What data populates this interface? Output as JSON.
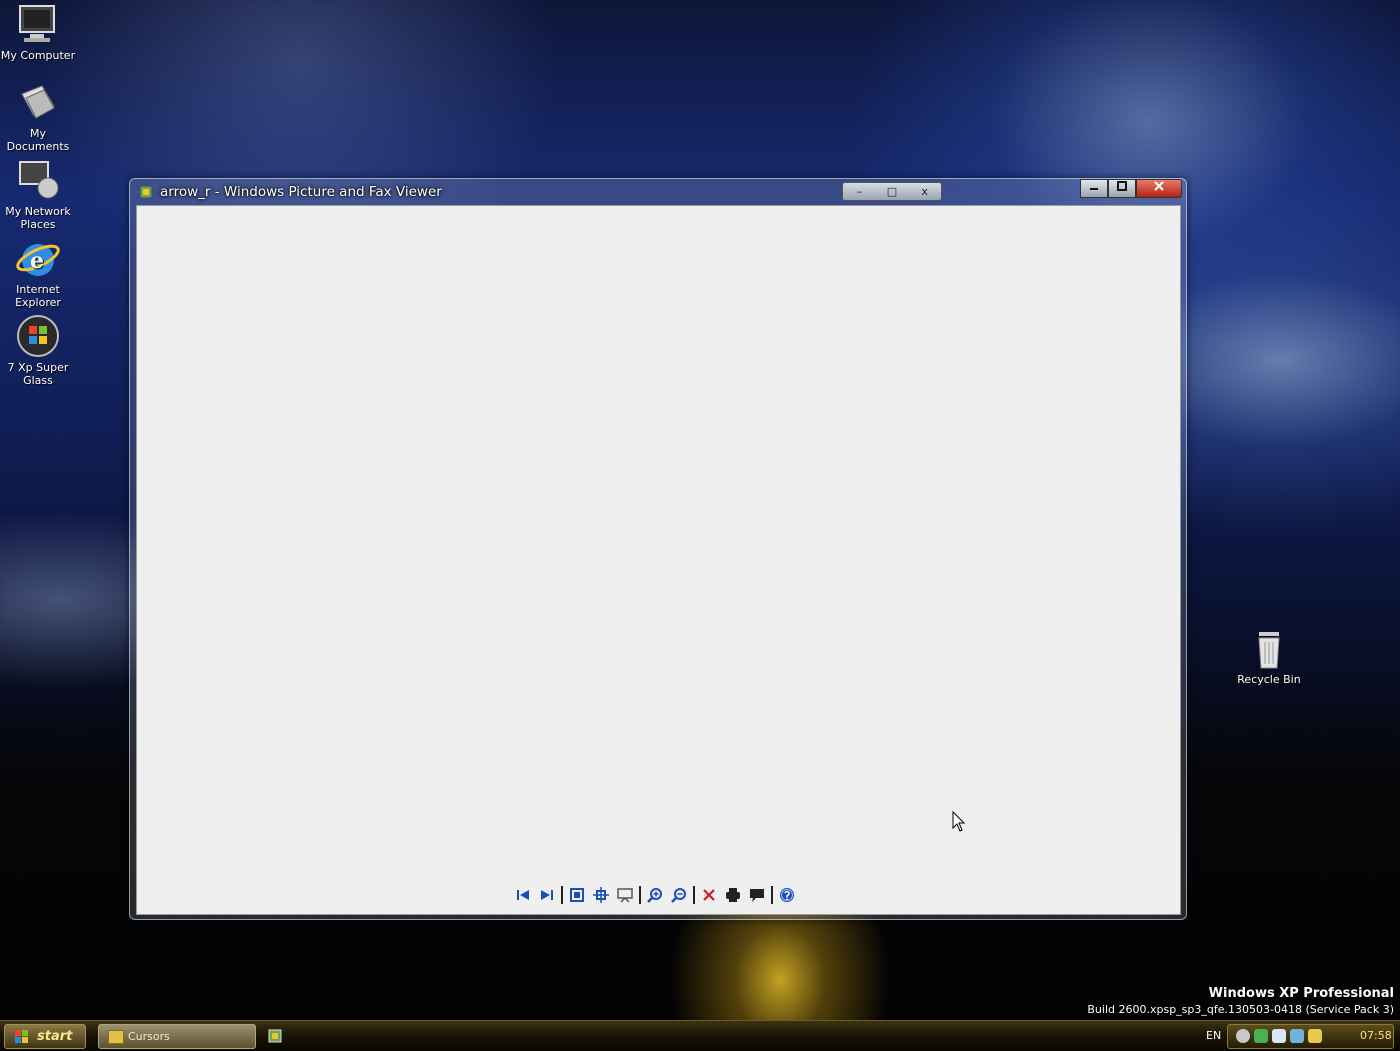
{
  "desktop": {
    "icons": [
      {
        "label": "My Computer",
        "icon": "my-computer-icon"
      },
      {
        "label": "My Documents",
        "icon": "my-documents-icon"
      },
      {
        "label": "My Network Places",
        "icon": "network-places-icon"
      },
      {
        "label": "Internet Explorer",
        "icon": "internet-explorer-icon"
      },
      {
        "label": "7 Xp Super Glass",
        "icon": "windows-orb-icon"
      },
      {
        "label": "Recycle Bin",
        "icon": "recycle-bin-icon"
      }
    ],
    "watermark": {
      "line1": "Windows XP Professional",
      "line2": "Build 2600.xpsp_sp3_qfe.130503-0418 (Service Pack 3)"
    }
  },
  "window": {
    "title": "arrow_r - Windows Picture and Fax Viewer",
    "inner_buttons": [
      "–",
      "□",
      "x"
    ],
    "outer_buttons": [
      "minimize",
      "maximize",
      "close"
    ],
    "toolbar": [
      "previous-image",
      "next-image",
      "separator",
      "best-fit",
      "actual-size",
      "slideshow",
      "separator",
      "zoom-in",
      "zoom-out",
      "separator",
      "delete",
      "print",
      "copy-to",
      "separator",
      "help"
    ]
  },
  "taskbar": {
    "start_label": "start",
    "task_buttons": [
      {
        "label": "Cursors",
        "icon": "folder-icon"
      }
    ],
    "language": "EN",
    "clock": "07:58"
  },
  "colors": {
    "client_bg": "#efefef",
    "taskbar_gold": "#ffe070",
    "toolbar_blue": "#1a4fb8",
    "delete_red": "#d21b1b"
  }
}
